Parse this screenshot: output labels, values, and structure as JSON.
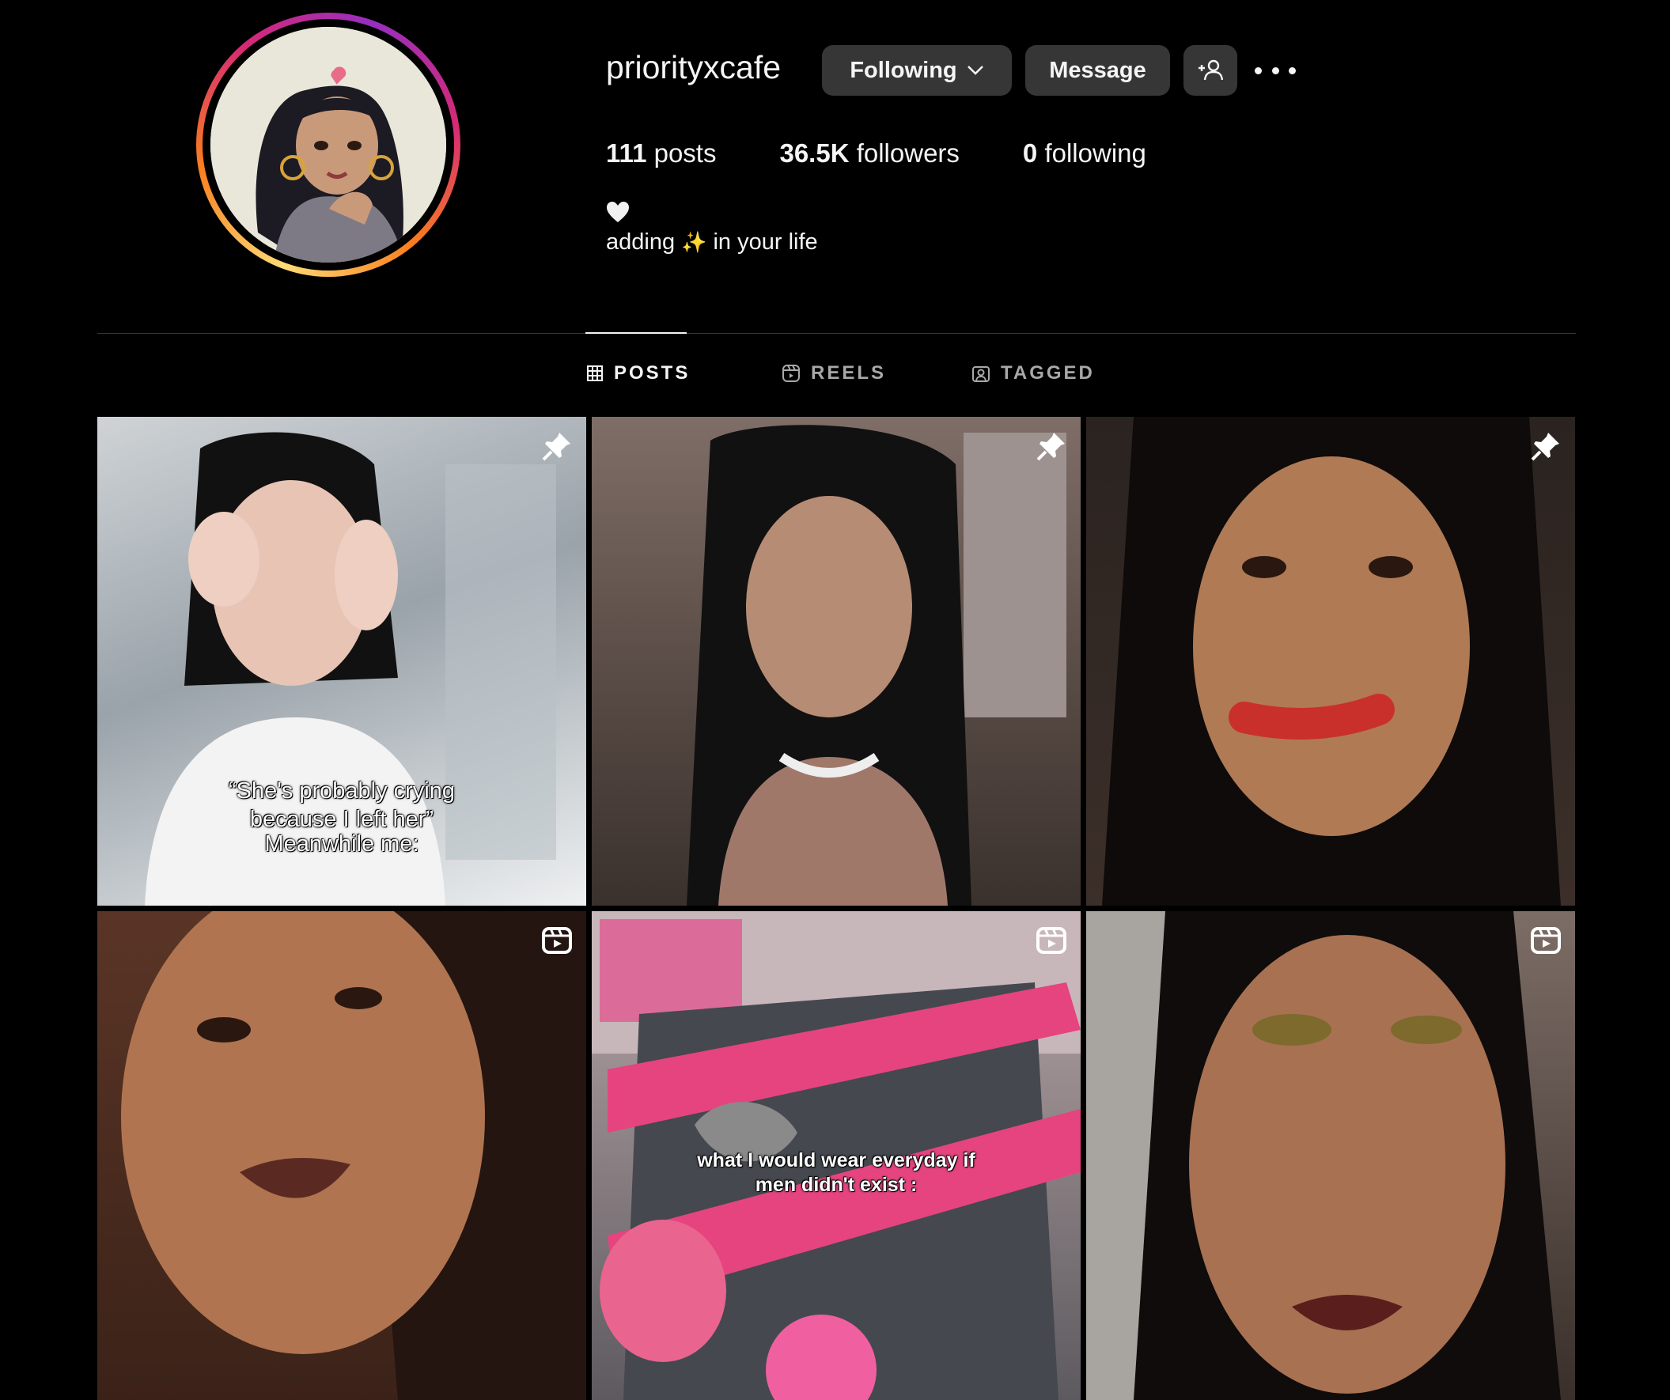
{
  "profile": {
    "username": "priorityxcafe",
    "follow_button": "Following",
    "message_button": "Message",
    "stats": {
      "posts_count": "111",
      "posts_label": "posts",
      "followers_count": "36.5K",
      "followers_label": "followers",
      "following_count": "0",
      "following_label": "following"
    },
    "bio_first": "adding",
    "bio_sparkle": "✨",
    "bio_rest": "in your life"
  },
  "tabs": {
    "posts": "POSTS",
    "reels": "REELS",
    "tagged": "TAGGED"
  },
  "posts": [
    {
      "type": "pinned",
      "caption_line1": "“She's probably crying",
      "caption_line2": "because I left her”",
      "caption_line3": "Meanwhile me:"
    },
    {
      "type": "pinned"
    },
    {
      "type": "pinned"
    },
    {
      "type": "reel"
    },
    {
      "type": "reel",
      "caption_line1": "what I would wear everyday if",
      "caption_line2": "men didn't exist :"
    },
    {
      "type": "reel"
    }
  ],
  "colors": {
    "background": "#000000",
    "button": "#363636",
    "text": "#f5f5f5",
    "muted": "#a8a8a8"
  }
}
